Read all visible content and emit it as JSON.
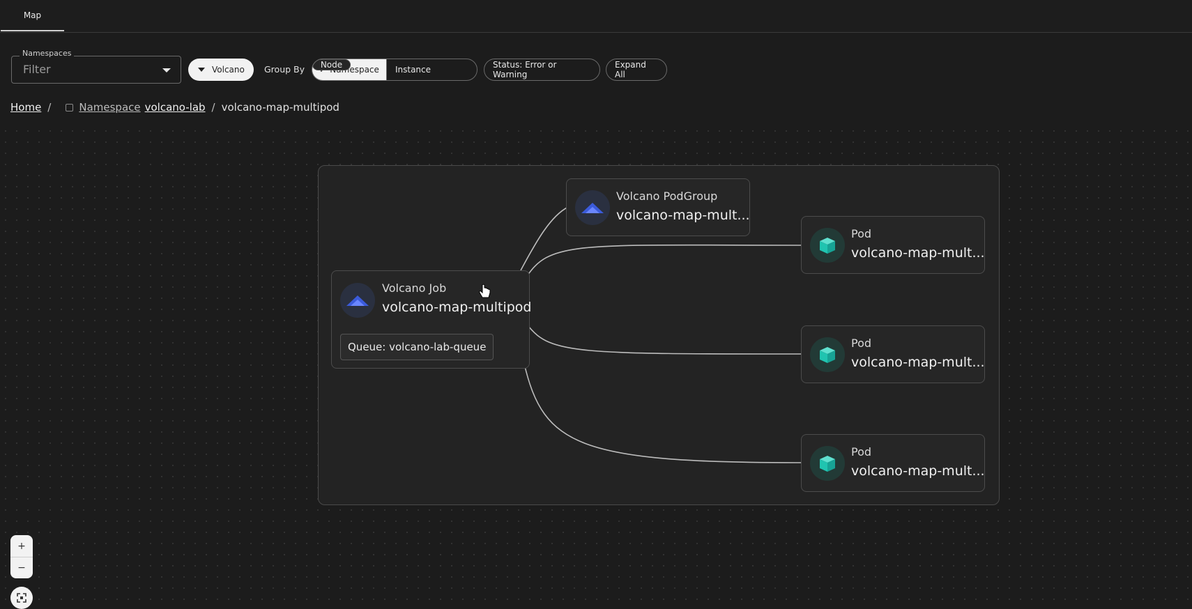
{
  "tabs": [
    {
      "label": "Map"
    }
  ],
  "filters": {
    "namespaces_label": "Namespaces",
    "namespaces_placeholder": "Filter",
    "volcano_chip": "Volcano",
    "group_by_label": "Group By",
    "group_by_options": [
      "Namespace",
      "Instance",
      "Node"
    ],
    "group_by_selected": "Namespace",
    "status_chip": "Status: Error or Warning",
    "expand_all": "Expand All"
  },
  "breadcrumb": {
    "home": "Home",
    "separator": "/",
    "namespace_prefix": "Namespace",
    "namespace_name": "volcano-lab",
    "current": "volcano-map-multipod"
  },
  "graph": {
    "job": {
      "kind": "Volcano Job",
      "name": "volcano-map-multipod",
      "queue": "Queue: volcano-lab-queue"
    },
    "podgroup": {
      "kind": "Volcano PodGroup",
      "name": "volcano-map-mult..."
    },
    "pods": [
      {
        "kind": "Pod",
        "name": "volcano-map-mult..."
      },
      {
        "kind": "Pod",
        "name": "volcano-map-mult..."
      },
      {
        "kind": "Pod",
        "name": "volcano-map-mult..."
      }
    ]
  },
  "zoom_controls": {
    "zoom_in": "+",
    "zoom_out": "−"
  },
  "colors": {
    "volcano_icon": "#3b5bdb",
    "pod_icon": "#20c4b0",
    "background": "#1c1c1c"
  }
}
